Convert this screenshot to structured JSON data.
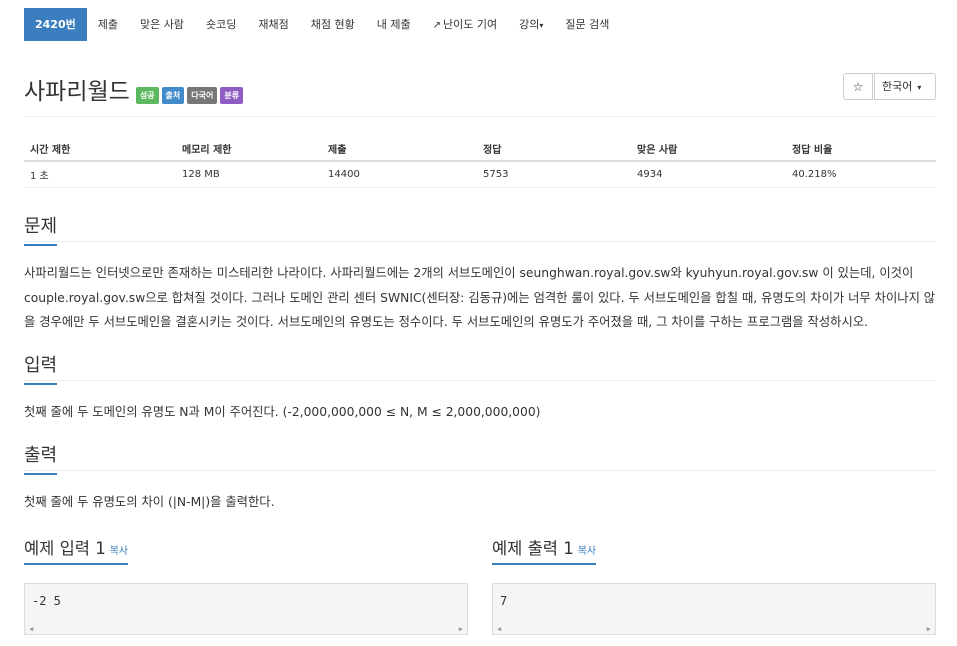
{
  "nav": {
    "tabs": [
      {
        "label": "2420번",
        "active": true
      },
      {
        "label": "제출"
      },
      {
        "label": "맞은 사람"
      },
      {
        "label": "숏코딩"
      },
      {
        "label": "재채점"
      },
      {
        "label": "채점 현황"
      },
      {
        "label": "내 제출"
      },
      {
        "label": "난이도 기여"
      },
      {
        "label": "강의"
      },
      {
        "label": "질문 검색"
      }
    ]
  },
  "problem": {
    "title": "사파리월드",
    "labels": [
      "성공",
      "출처",
      "다국어",
      "분류"
    ],
    "language": "한국어"
  },
  "info": {
    "headers": [
      "시간 제한",
      "메모리 제한",
      "제출",
      "정답",
      "맞은 사람",
      "정답 비율"
    ],
    "values": [
      "1 초",
      "128 MB",
      "14400",
      "5753",
      "4934",
      "40.218%"
    ]
  },
  "sections": {
    "problem_title": "문제",
    "problem_text": "사파리월드는 인터넷으로만 존재하는 미스테리한 나라이다. 사파리월드에는 2개의 서브도메인이 seunghwan.royal.gov.sw와 kyuhyun.royal.gov.sw 이 있는데, 이것이 couple.royal.gov.sw으로 합쳐질 것이다. 그러나 도메인 관리 센터 SWNIC(센터장: 김동규)에는 엄격한 룰이 있다. 두 서브도메인을 합칠 때, 유명도의 차이가 너무 차이나지 않을 경우에만 두 서브도메인을 결혼시키는 것이다. 서브도메인의 유명도는 정수이다. 두 서브도메인의 유명도가 주어졌을 때, 그 차이를 구하는 프로그램을 작성하시오.",
    "input_title": "입력",
    "input_text": "첫째 줄에 두 도메인의 유명도 N과 M이 주어진다. (-2,000,000,000 ≤ N, M ≤ 2,000,000,000)",
    "output_title": "출력",
    "output_text": "첫째 줄에 두 유명도의 차이 (|N-M|)을 출력한다."
  },
  "samples": {
    "input_title": "예제 입력 1",
    "output_title": "예제 출력 1",
    "copy_label": "복사",
    "input_value": "-2 5",
    "output_value": "7"
  },
  "icons": {
    "star": "☆",
    "caret": "▾",
    "external": "↗"
  },
  "colors": {
    "accent": "#3a7ebf",
    "success_label": "#5cb85c",
    "source_label": "#428bca",
    "multilang_label": "#777777",
    "category_label": "#8e5cc2"
  }
}
